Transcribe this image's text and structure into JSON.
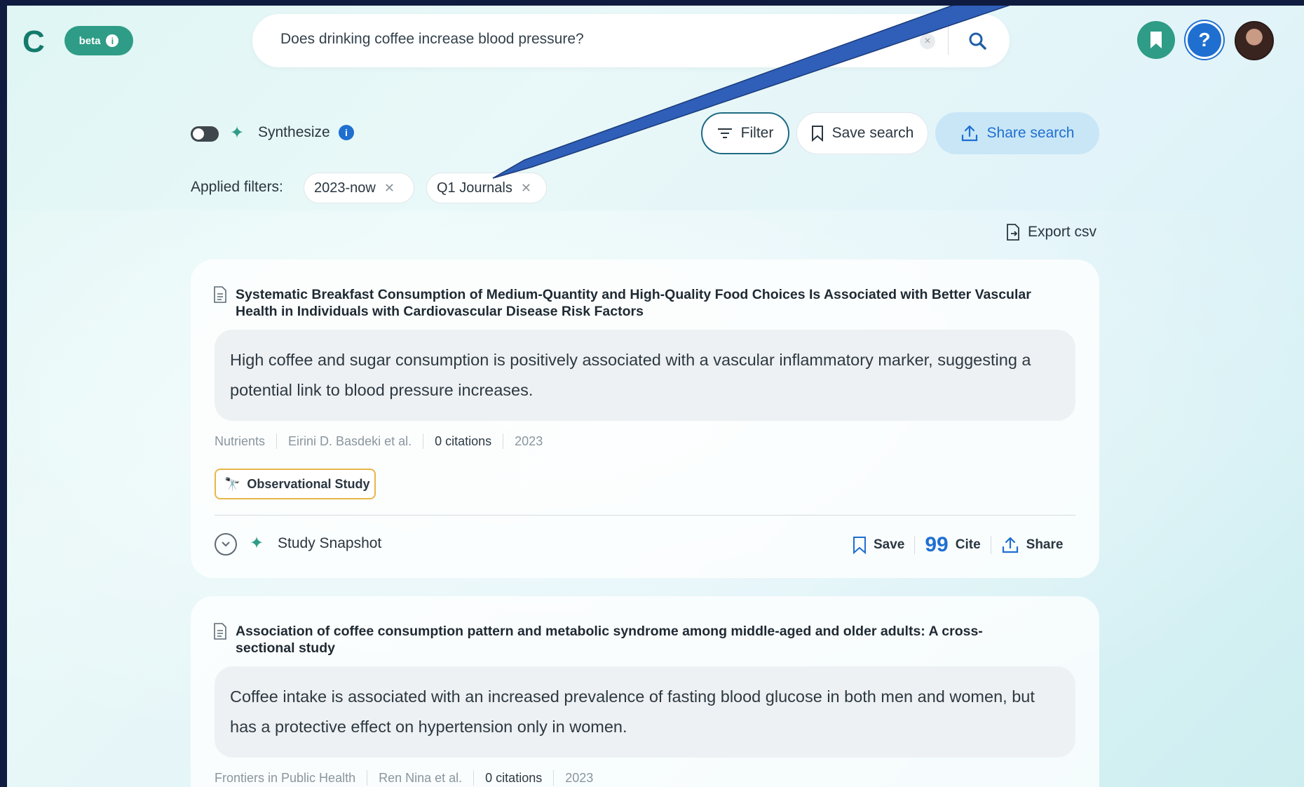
{
  "header": {
    "logo": "C",
    "beta_label": "beta",
    "search": {
      "query": "Does drinking coffee increase blood pressure?"
    }
  },
  "toolbar": {
    "synthesize_label": "Synthesize",
    "filter_label": "Filter",
    "save_search_label": "Save search",
    "share_search_label": "Share search"
  },
  "filters": {
    "label": "Applied filters:",
    "chips": [
      "2023-now",
      "Q1 Journals"
    ]
  },
  "export_label": "Export csv",
  "results": [
    {
      "title_line1": "Systematic Breakfast Consumption of Medium-Quantity and High-Quality Food Choices Is Associated with Better Vascular",
      "title_line2": "Health in Individuals with Cardiovascular Disease Risk Factors",
      "summary_line1": "High coffee and sugar consumption is positively associated with a vascular inflammatory marker, suggesting a",
      "summary_line2": "potential link to blood pressure increases.",
      "journal": "Nutrients",
      "authors": "Eirini D. Basdeki et al.",
      "citations": "0 citations",
      "year": "2023",
      "badge": "Observational Study",
      "snapshot_label": "Study Snapshot",
      "save_label": "Save",
      "cite_label": "Cite",
      "share_label": "Share"
    },
    {
      "title_line1": "Association of coffee consumption pattern and metabolic syndrome among middle-aged and older adults: A cross-",
      "title_line2": "sectional study",
      "summary_line1": "Coffee intake is associated with an increased prevalence of fasting blood glucose in both men and women, but",
      "summary_line2": "has a protective effect on hypertension only in women.",
      "journal": "Frontiers in Public Health",
      "authors": "Ren Nina et al.",
      "citations": "0 citations",
      "year": "2023"
    }
  ],
  "colors": {
    "brand": "#2e9c86",
    "accent_blue": "#1f6fd1",
    "annotation_arrow": "#2f5fb8",
    "badge_border": "#e8b64b"
  },
  "icons": [
    "search-icon",
    "clear-icon",
    "bookmark-icon",
    "help-icon",
    "info-icon",
    "sparkle-icon",
    "filter-icon",
    "share-icon",
    "export-icon",
    "document-icon",
    "binoculars-icon",
    "chevron-down-icon",
    "quote-icon"
  ]
}
